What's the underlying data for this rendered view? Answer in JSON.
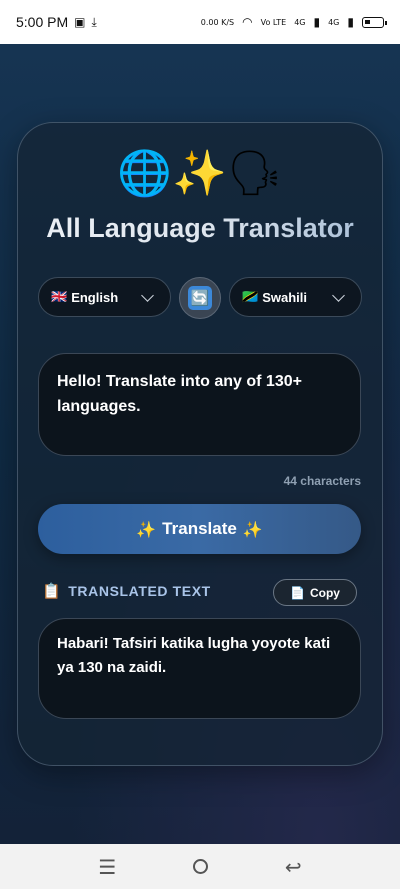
{
  "status_bar": {
    "time": "5:00 PM",
    "net_speed": "0.00 K/S",
    "net_type_1": "Vo LTE",
    "net_type_2": "4G",
    "net_type_3": "4G"
  },
  "app": {
    "header_emoji": "🌐✨🗣",
    "title": "All Language Translator"
  },
  "source_language": {
    "flag": "🇬🇧",
    "label": "English"
  },
  "target_language": {
    "flag": "🇹🇿",
    "label": "Swahili"
  },
  "swap_icon": "🔄",
  "input": {
    "value": "Hello! Translate into any of 130+ languages."
  },
  "char_count": "44 characters",
  "translate_button": {
    "left_emoji": "✨",
    "label": "Translate",
    "right_emoji": "✨"
  },
  "output_section": {
    "icon": "📋",
    "label": "TRANSLATED TEXT",
    "copy_icon": "📄",
    "copy_label": "Copy",
    "value": "Habari! Tafsiri katika lugha yoyote kati ya 130 na zaidi."
  },
  "nav": {
    "menu_icon": "☰",
    "back_icon": "↩"
  }
}
